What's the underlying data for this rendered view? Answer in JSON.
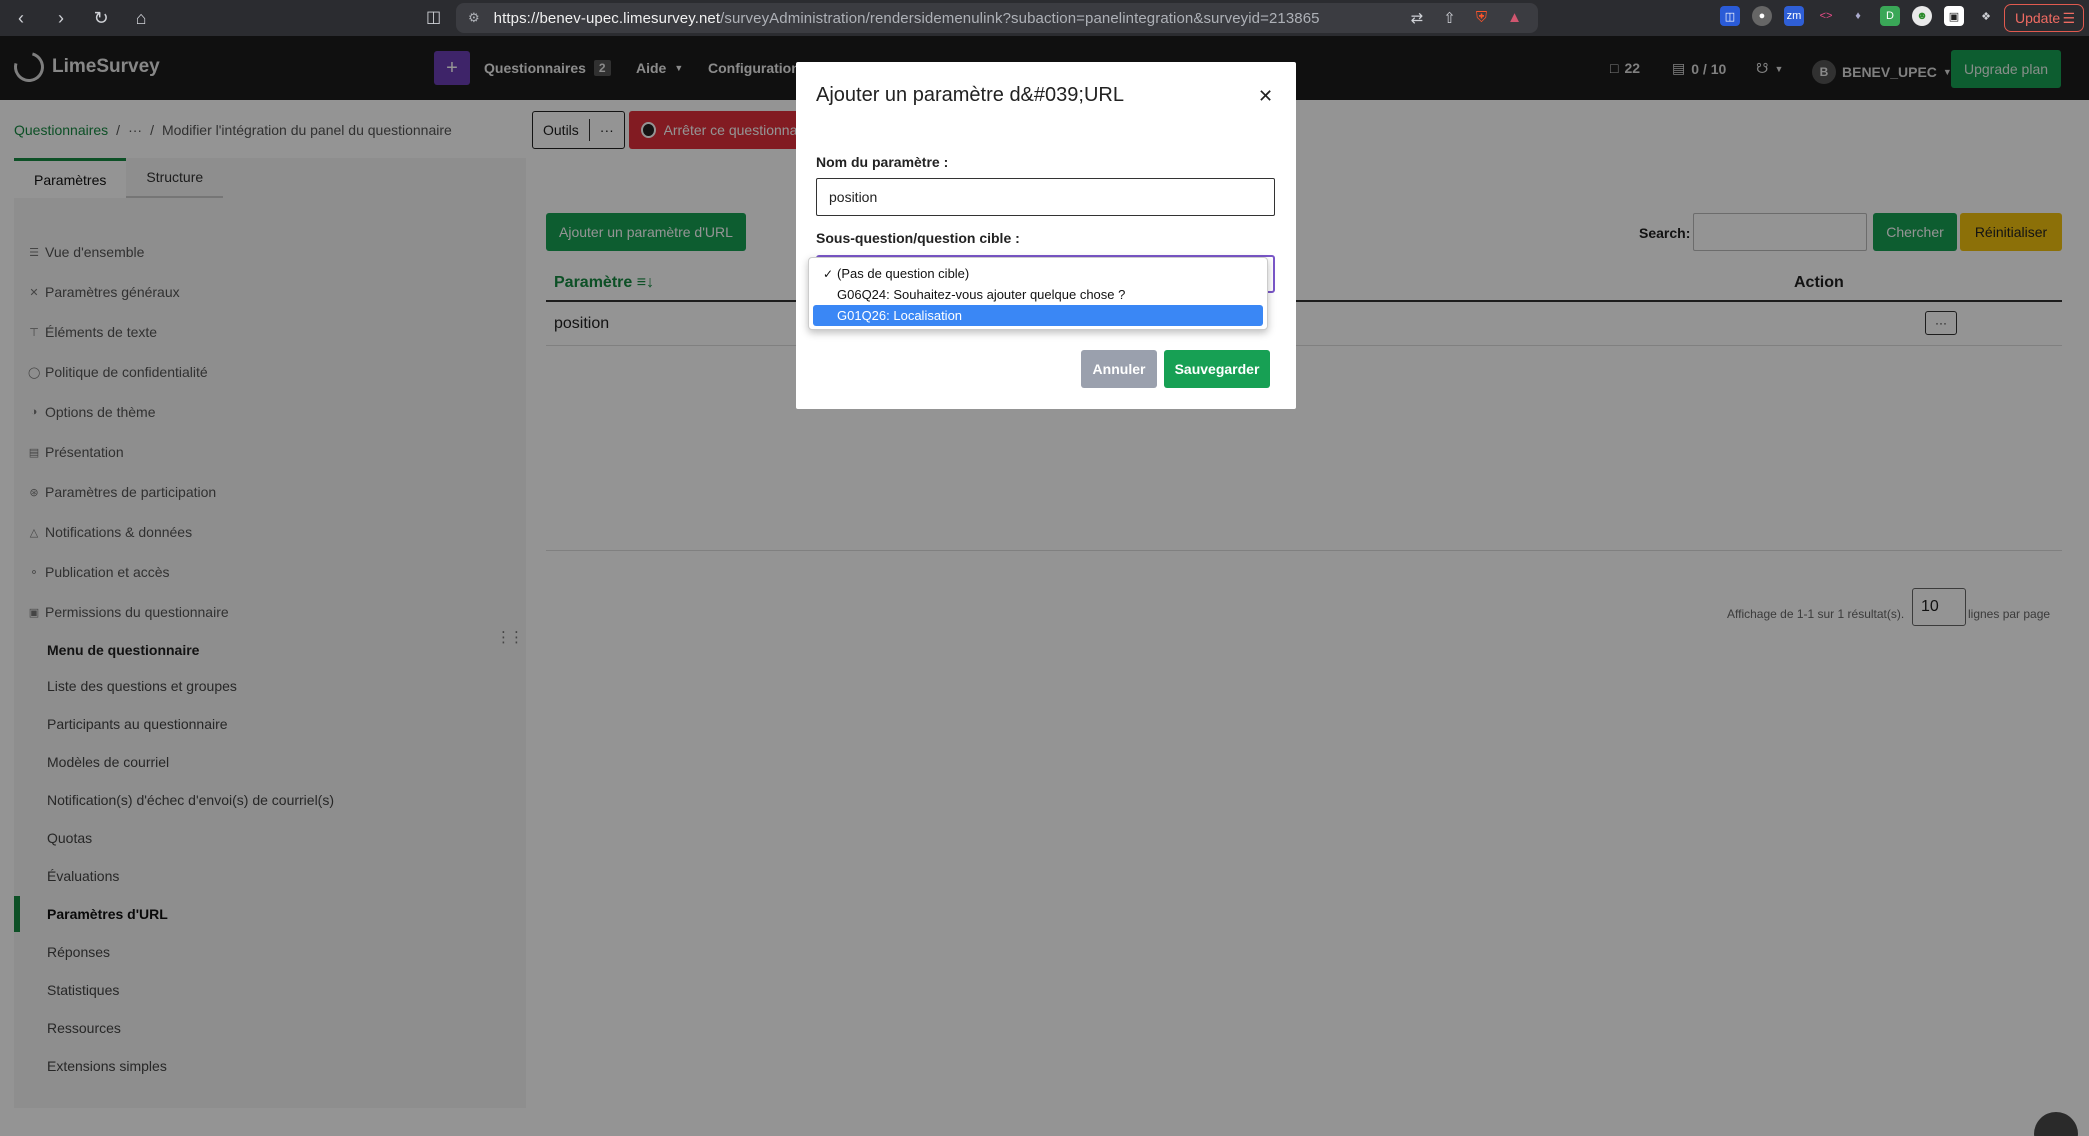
{
  "browser": {
    "url_host": "https://benev-upec.limesurvey.net",
    "url_path": "/surveyAdministration/rendersidemenulink?subaction=panelintegration&surveyid=213865",
    "update_label": "Update"
  },
  "header": {
    "logo": "LimeSurvey",
    "nav": [
      {
        "label": "Questionnaires",
        "badge": "2"
      },
      {
        "label": "Aide"
      },
      {
        "label": "Configuration"
      }
    ],
    "messages_count": "22",
    "storage": "0 / 10",
    "avatar_initial": "B",
    "user": "BENEV_UPEC",
    "upgrade": "Upgrade plan"
  },
  "breadcrumb": {
    "root": "Questionnaires",
    "ellipsis": "···",
    "current": "Modifier l'intégration du panel du questionnaire"
  },
  "toolbar": {
    "outils": "Outils",
    "stop": "Arrêter ce questionnaire"
  },
  "sidebar": {
    "tabs": [
      "Paramètres",
      "Structure"
    ],
    "items": [
      {
        "label": "Vue d'ensemble",
        "icon": "list-icon"
      },
      {
        "label": "Paramètres généraux",
        "icon": "tools-icon"
      },
      {
        "label": "Éléments de texte",
        "icon": "text-icon"
      },
      {
        "label": "Politique de confidentialité",
        "icon": "shield-icon"
      },
      {
        "label": "Options de thème",
        "icon": "contrast-icon"
      },
      {
        "label": "Présentation",
        "icon": "layout-icon"
      },
      {
        "label": "Paramètres de participation",
        "icon": "participants-icon"
      },
      {
        "label": "Notifications & données",
        "icon": "bell-icon"
      },
      {
        "label": "Publication et accès",
        "icon": "key-icon"
      },
      {
        "label": "Permissions du questionnaire",
        "icon": "lock-icon"
      }
    ],
    "menu_title": "Menu de questionnaire",
    "menu": [
      "Liste des questions et groupes",
      "Participants au questionnaire",
      "Modèles de courriel",
      "Notification(s) d'échec d'envoi(s) de courriel(s)",
      "Quotas",
      "Évaluations",
      "Paramètres d'URL",
      "Réponses",
      "Statistiques",
      "Ressources",
      "Extensions simples"
    ],
    "active_menu": "Paramètres d'URL"
  },
  "main": {
    "add_button": "Ajouter un paramètre d'URL",
    "search_label": "Search:",
    "search_value": "",
    "search_button": "Chercher",
    "reset_button": "Réinitialiser",
    "columns": [
      "Paramètre",
      "Action"
    ],
    "rows": [
      {
        "param": "position"
      }
    ],
    "pager_text": "Affichage de 1-1 sur 1 résultat(s).",
    "page_size": "10",
    "pager_suffix": "lignes par page"
  },
  "modal": {
    "title": "Ajouter un paramètre d&#039;URL",
    "name_label": "Nom du paramètre :",
    "name_value": "position",
    "target_label": "Sous-question/question cible :",
    "options": [
      {
        "label": "(Pas de question cible)",
        "checked": true,
        "highlighted": false
      },
      {
        "label": "G06Q24: Souhaitez-vous ajouter quelque chose ?",
        "checked": false,
        "highlighted": false
      },
      {
        "label": "G01Q26: Localisation",
        "checked": false,
        "highlighted": true
      }
    ],
    "cancel": "Annuler",
    "save": "Sauvegarder"
  },
  "colors": {
    "accent_green": "#17a054",
    "danger": "#e0303c",
    "warning": "#f2c20f",
    "purple": "#6b3fb5",
    "highlight": "#3a87f5"
  }
}
